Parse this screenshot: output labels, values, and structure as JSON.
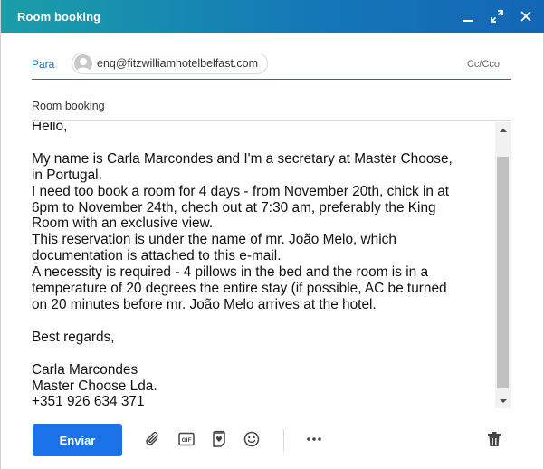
{
  "window": {
    "title": "Room booking",
    "controls": [
      "minimize-icon",
      "fullscreen-icon",
      "close-icon"
    ]
  },
  "compose": {
    "to_label": "Para",
    "recipient": "enq@fitzwilliamhotelbelfast.com",
    "cc_label": "Cc/Cco",
    "subject": "Room booking",
    "body": "Hello,\n\nMy name is Carla Marcondes and I'm a secretary at Master Choose,\nin Portugal.\nI need too book a room for 4 days - from November 20th, chick in at\n6pm to November 24th, chech out at 7:30 am, preferably the King\nRoom with an exclusive view.\nThis reservation is under the name of mr. João Melo, which\ndocumentation is attached to this e-mail.\nA necessity is required - 4 pillows in the bed and the room is in a\ntemperature of 20 degrees the entire stay (if possible, AC be turned\non 20 minutes before mr. João Melo arrives at the hotel.\n\nBest regards,\n\nCarla Marcondes\nMaster Choose Lda.\n+351 926 634 371"
  },
  "footer": {
    "send_label": "Enviar",
    "gif_label": "GIF",
    "tools": [
      "attach-icon",
      "gif-icon",
      "sticker-icon",
      "emoji-icon",
      "more-icon",
      "trash-icon"
    ]
  },
  "colors": {
    "titlebar_start": "#1a9ea8",
    "titlebar_end": "#1366b5",
    "send_button": "#1a73e8",
    "label_blue": "#1a73b6"
  }
}
